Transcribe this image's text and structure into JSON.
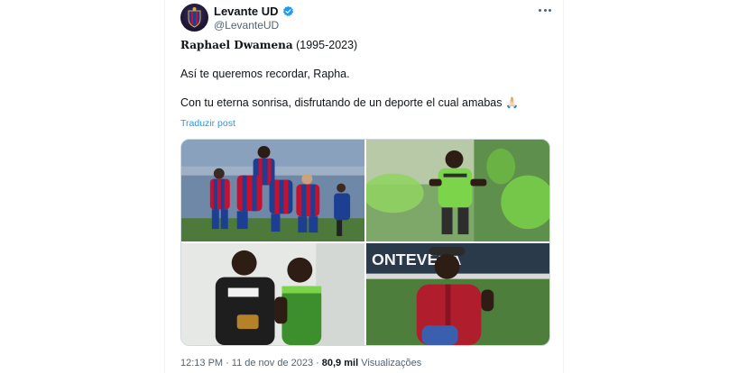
{
  "author": {
    "name": "Levante UD",
    "handle": "@LevanteUD",
    "verified_color": "#1d9bf0"
  },
  "tweet": {
    "title_name": "Raphael Dwamena",
    "title_years": " (1995-2023)",
    "line2": "Así te queremos recordar, Rapha.",
    "line3": "Con tu eterna sonrisa, disfrutando de un deporte el cual amabas",
    "emoji": "🙏🏻",
    "translate_label": "Traduzir post"
  },
  "media": {
    "photo2_sign": "ONTEVERA"
  },
  "meta": {
    "time": "12:13 PM",
    "date": "11 de nov de 2023",
    "views_count": "80,9 mil",
    "views_label": "Visualizações",
    "dot": "·"
  },
  "icons": {
    "verified": "verified-badge-icon",
    "more": "more-options-icon"
  },
  "colors": {
    "levante_blue": "#1c3f94",
    "levante_red": "#c8102e",
    "training_green": "#7bd44a",
    "link_blue": "#1d9bf0",
    "text_secondary": "#536471"
  }
}
